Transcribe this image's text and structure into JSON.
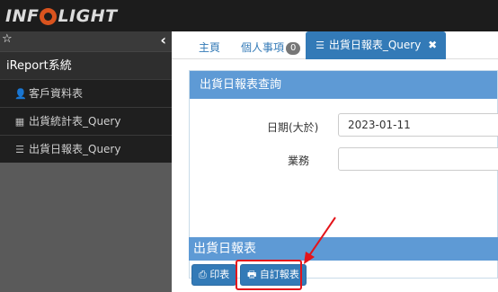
{
  "header": {
    "logo_text_left": "INF",
    "logo_text_right": "LIGHT"
  },
  "sidebar": {
    "star_glyph": "☆",
    "collapse_glyph": "‹",
    "group_label": "iReport系統",
    "items": [
      {
        "label": "客戶資料表",
        "icon": "user-icon"
      },
      {
        "label": "出貨統計表_Query",
        "icon": "table-icon"
      },
      {
        "label": "出貨日報表_Query",
        "icon": "list-icon"
      }
    ]
  },
  "tabs": {
    "home": "主頁",
    "personal": "個人事項",
    "personal_badge": "0",
    "active": "出貨日報表_Query",
    "close_glyph": "✖"
  },
  "query_panel": {
    "title": "出貨日報表查詢",
    "date_label": "日期(大於)",
    "date_value": "2023-01-11",
    "sales_label": "業務",
    "sales_value": ""
  },
  "report": {
    "title": "出貨日報表",
    "print_label": "印表",
    "custom_label": "自訂報表"
  },
  "colors": {
    "primary": "#337ab7",
    "panel_head": "#5e9ad5",
    "annotation": "#e4141a"
  }
}
